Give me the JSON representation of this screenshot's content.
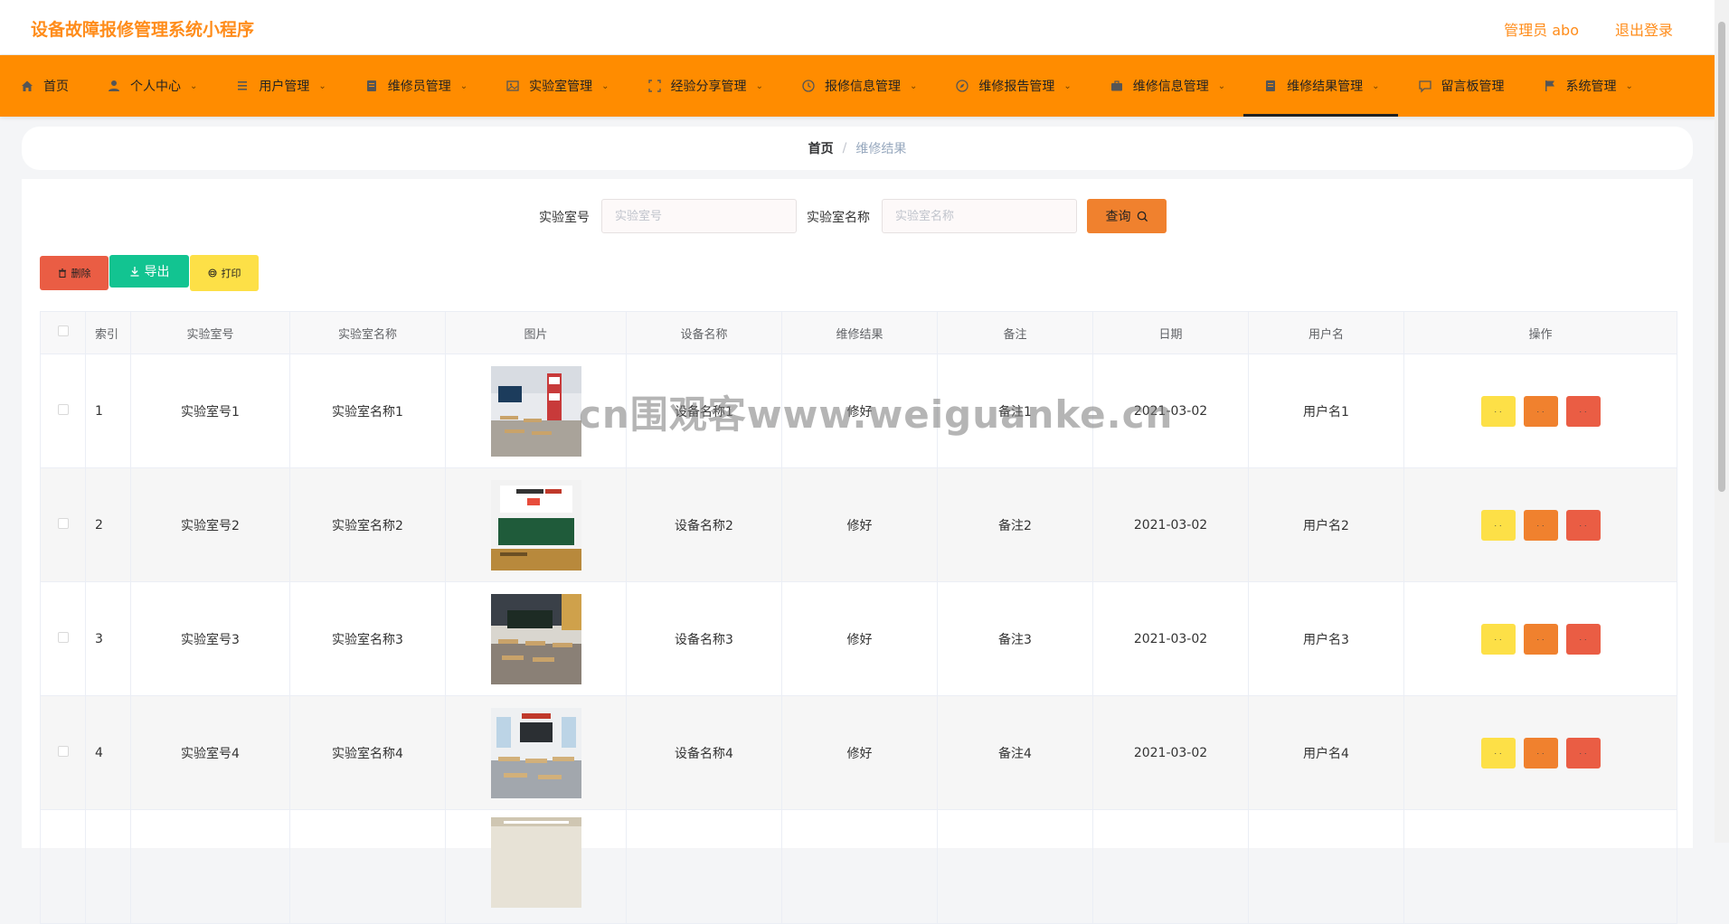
{
  "header": {
    "app_title": "设备故障报修管理系统小程序",
    "admin_label": "管理员 abo",
    "logout_label": "退出登录"
  },
  "nav": {
    "items": [
      {
        "label": "首页",
        "icon": "home-icon",
        "dropdown": false
      },
      {
        "label": "个人中心",
        "icon": "user-icon",
        "dropdown": true
      },
      {
        "label": "用户管理",
        "icon": "list-icon",
        "dropdown": true
      },
      {
        "label": "维修员管理",
        "icon": "document-icon",
        "dropdown": true
      },
      {
        "label": "实验室管理",
        "icon": "image-icon",
        "dropdown": true
      },
      {
        "label": "经验分享管理",
        "icon": "frame-icon",
        "dropdown": true
      },
      {
        "label": "报修信息管理",
        "icon": "clock-icon",
        "dropdown": true
      },
      {
        "label": "维修报告管理",
        "icon": "compass-icon",
        "dropdown": true
      },
      {
        "label": "维修信息管理",
        "icon": "briefcase-icon",
        "dropdown": true
      },
      {
        "label": "维修结果管理",
        "icon": "document-icon",
        "dropdown": true,
        "active": true
      },
      {
        "label": "留言板管理",
        "icon": "message-icon",
        "dropdown": false
      },
      {
        "label": "系统管理",
        "icon": "flag-icon",
        "dropdown": true
      }
    ]
  },
  "breadcrumb": {
    "home": "首页",
    "separator": "/",
    "current": "维修结果"
  },
  "search": {
    "lab_no_label": "实验室号",
    "lab_no_placeholder": "实验室号",
    "lab_name_label": "实验室名称",
    "lab_name_placeholder": "实验室名称",
    "query_label": "查询"
  },
  "actions": {
    "delete_label": "删除",
    "export_label": "导出",
    "print_label": "打印"
  },
  "table": {
    "headers": [
      "索引",
      "实验室号",
      "实验室名称",
      "图片",
      "设备名称",
      "维修结果",
      "备注",
      "日期",
      "用户名",
      "操作"
    ],
    "rows": [
      {
        "index": "1",
        "lab_no": "实验室号1",
        "lab_name": "实验室名称1",
        "device": "设备名称1",
        "result": "修好",
        "note": "备注1",
        "date": "2021-03-02",
        "user": "用户名1"
      },
      {
        "index": "2",
        "lab_no": "实验室号2",
        "lab_name": "实验室名称2",
        "device": "设备名称2",
        "result": "修好",
        "note": "备注2",
        "date": "2021-03-02",
        "user": "用户名2"
      },
      {
        "index": "3",
        "lab_no": "实验室号3",
        "lab_name": "实验室名称3",
        "device": "设备名称3",
        "result": "修好",
        "note": "备注3",
        "date": "2021-03-02",
        "user": "用户名3"
      },
      {
        "index": "4",
        "lab_no": "实验室号4",
        "lab_name": "实验室名称4",
        "device": "设备名称4",
        "result": "修好",
        "note": "备注4",
        "date": "2021-03-02",
        "user": "用户名4"
      },
      {
        "index": "",
        "lab_no": "",
        "lab_name": "",
        "device": "",
        "result": "",
        "note": "",
        "date": "",
        "user": ""
      }
    ]
  },
  "watermark": "cn围观客www.weiguanke.cn",
  "colors": {
    "brand": "#ff8c1a",
    "nav_bg": "#ff8c00",
    "query_btn": "#f0812e",
    "delete_btn": "#ea5d44",
    "export_btn": "#12c491",
    "print_btn": "#fde047"
  }
}
